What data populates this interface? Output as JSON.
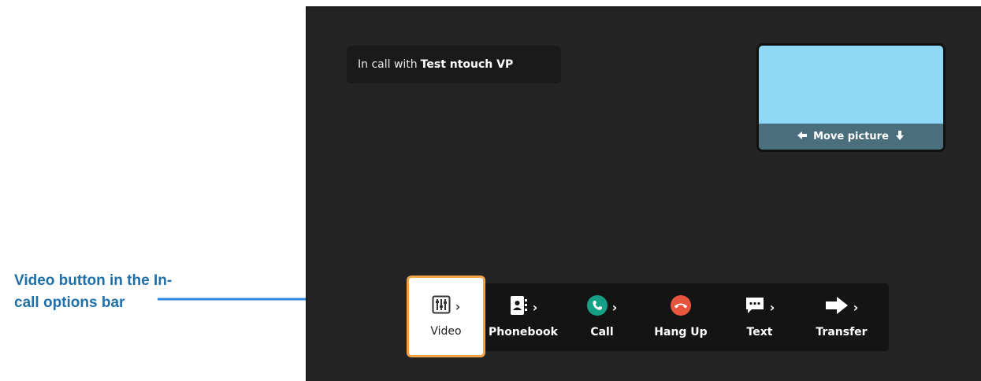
{
  "annotation": {
    "line1": "Video button in the In-",
    "line2": "call options bar"
  },
  "call": {
    "prefix": "In call with",
    "name": "Test ntouch VP"
  },
  "pip": {
    "label": "Move picture"
  },
  "options": {
    "video": "Video",
    "phonebook": "Phonebook",
    "call": "Call",
    "hangup": "Hang Up",
    "text": "Text",
    "transfer": "Transfer"
  },
  "colors": {
    "accent_selected": "#f4a54a",
    "call_green": "#16a085",
    "hangup_red": "#e8553e",
    "annotation_blue": "#1f6fa8",
    "pip_blue": "#8fd8f6"
  }
}
